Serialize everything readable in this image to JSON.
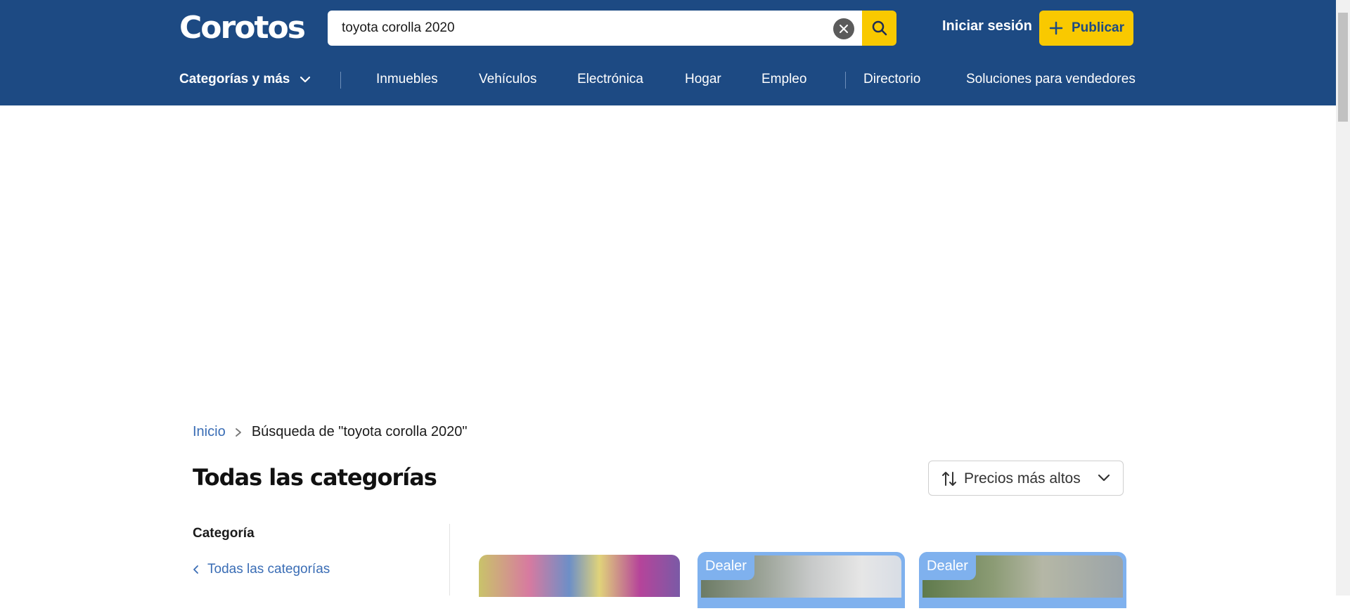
{
  "header": {
    "logo": "Corotos",
    "search": {
      "value": "toyota corolla 2020"
    },
    "login_label": "Iniciar sesión",
    "publish_label": "Publicar",
    "nav": {
      "categories_label": "Categorías y más",
      "items": [
        "Inmuebles",
        "Vehículos",
        "Electrónica",
        "Hogar",
        "Empleo",
        "Directorio",
        "Soluciones para vendedores"
      ]
    }
  },
  "breadcrumb": {
    "home": "Inicio",
    "current": "Búsqueda de \"toyota corolla 2020\""
  },
  "page_title": "Todas las categorías",
  "sort": {
    "selected": "Precios más altos"
  },
  "filters": {
    "heading": "Categoría",
    "back_label": "Todas las categorías"
  },
  "listings": [
    {
      "badge": ""
    },
    {
      "badge": "Dealer"
    },
    {
      "badge": "Dealer"
    }
  ],
  "colors": {
    "brand_blue": "#1d4a83",
    "accent_yellow": "#f9c900",
    "link_blue": "#3a6db5",
    "dealer_badge": "#7fb1ee"
  },
  "icons": [
    "close-icon",
    "search-icon",
    "plus-icon",
    "chevron-down-icon",
    "chevron-right-icon",
    "sort-icon",
    "chevron-left-icon"
  ]
}
